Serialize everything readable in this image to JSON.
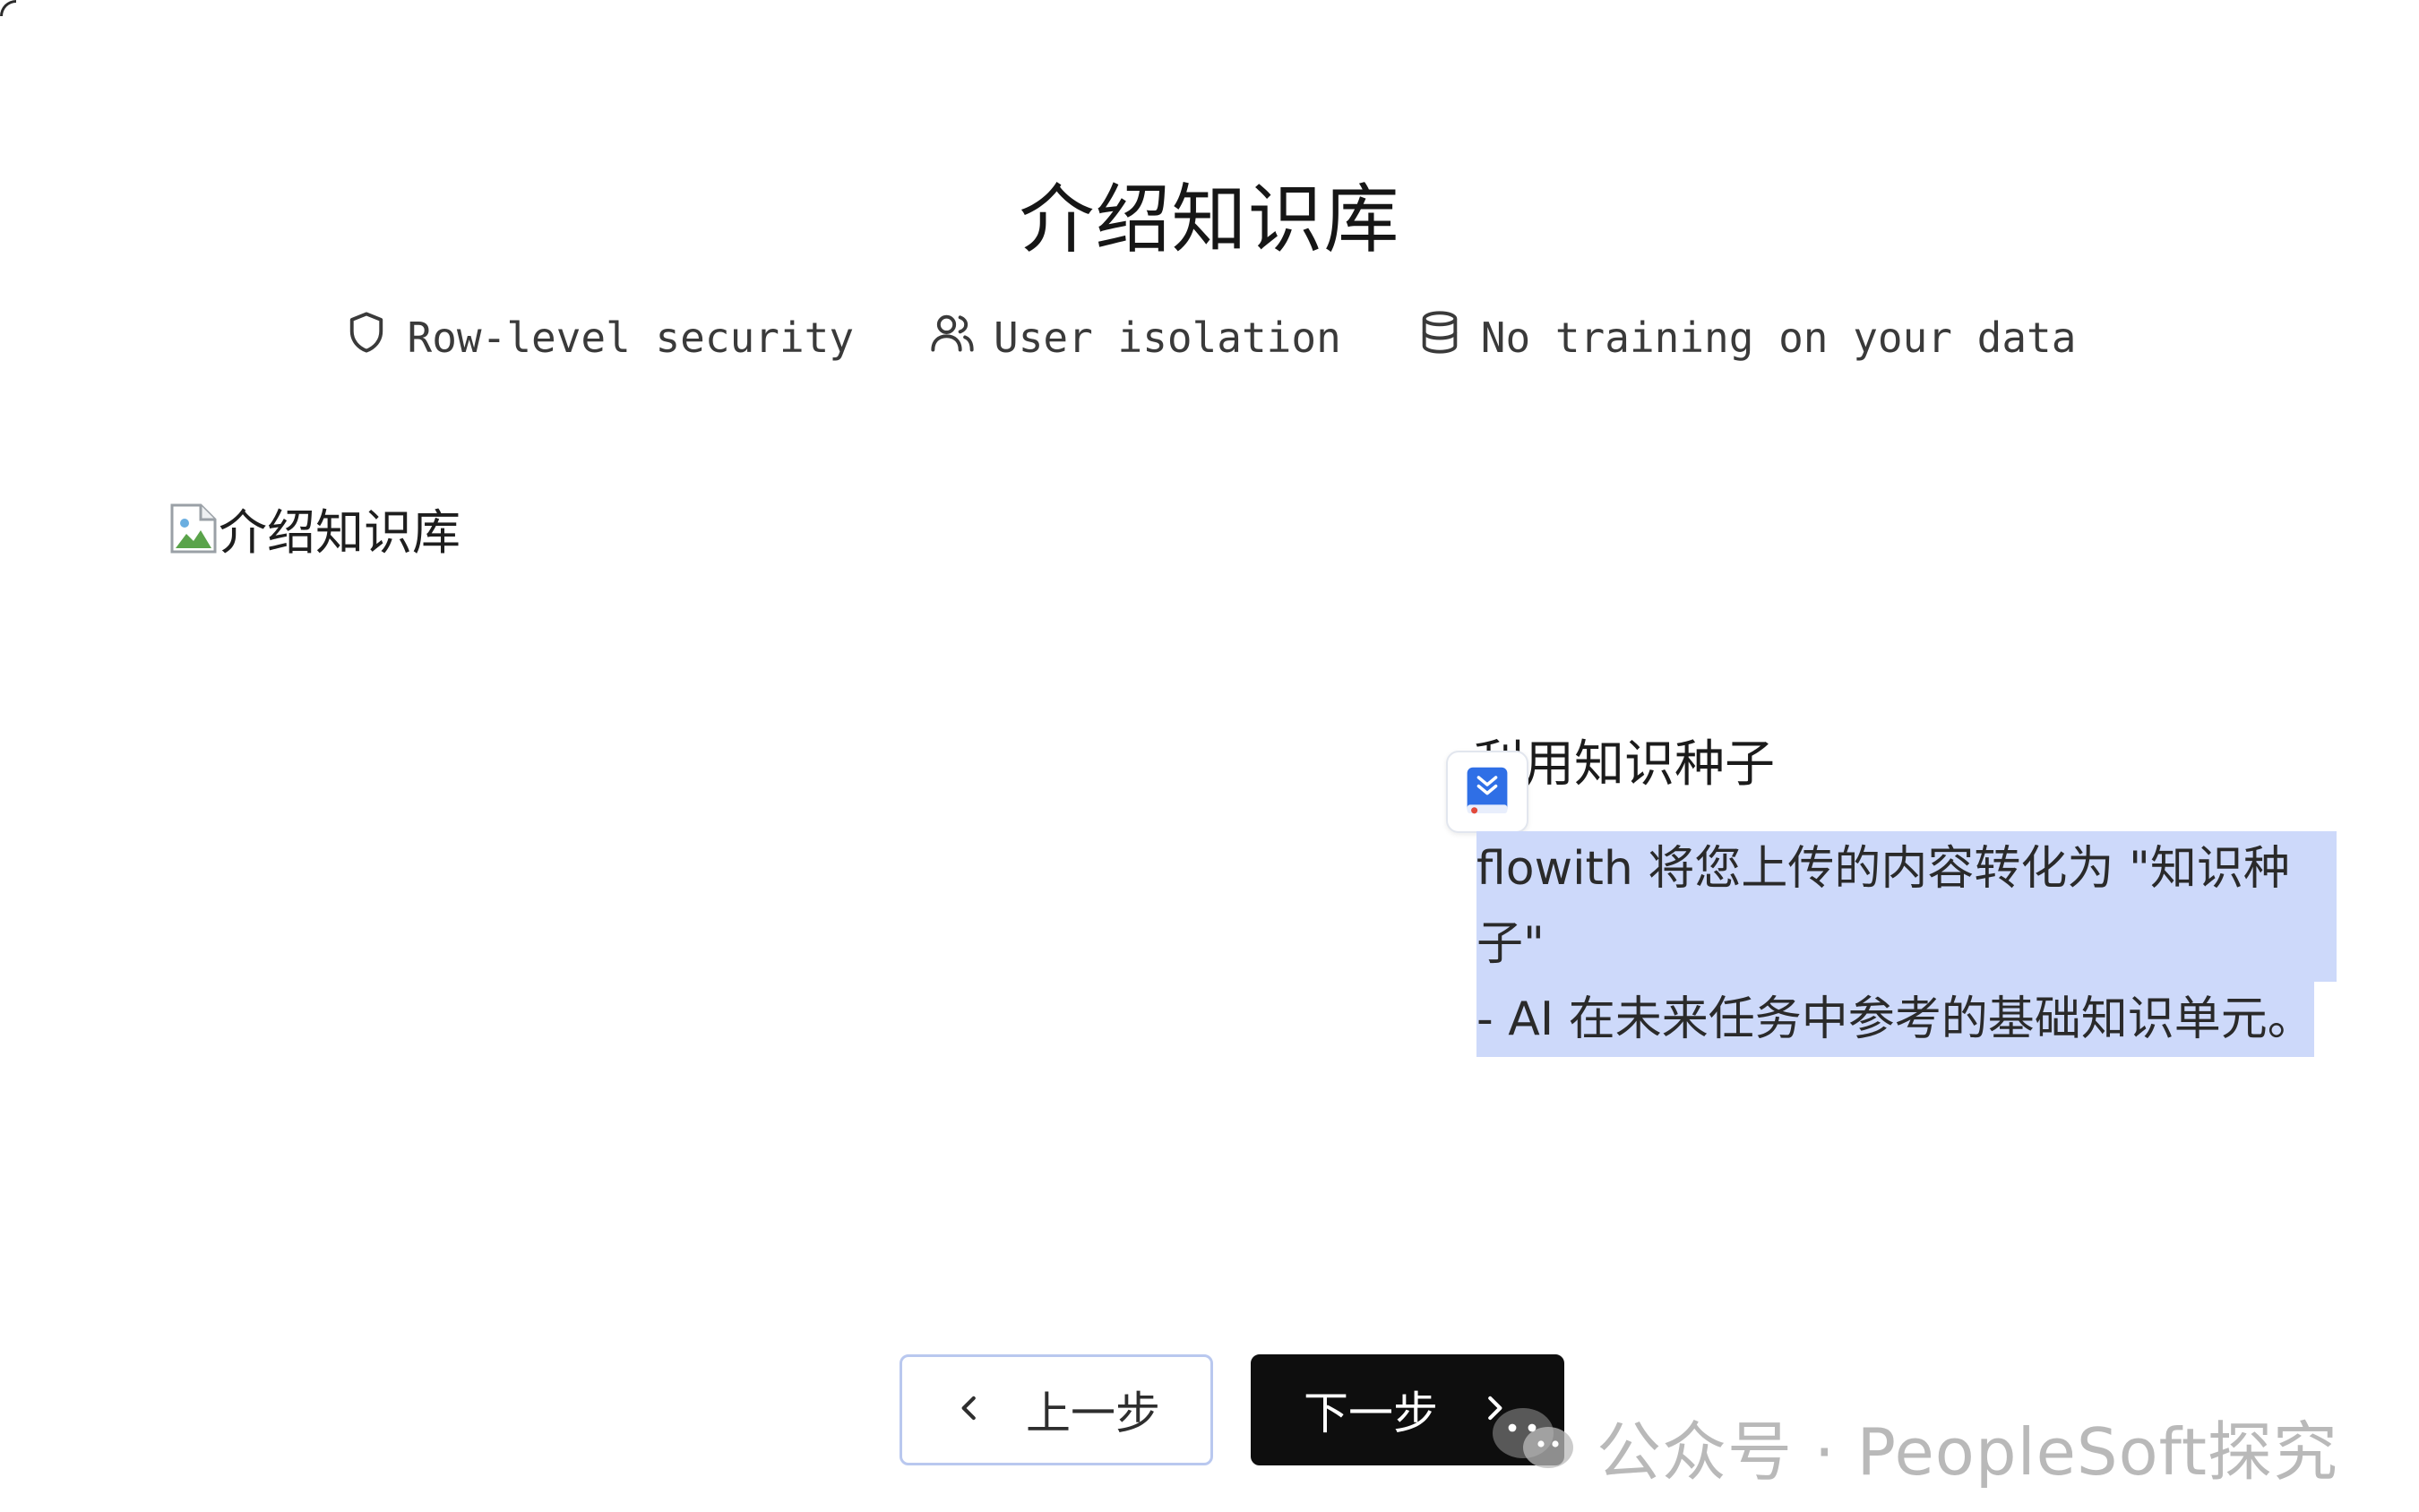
{
  "modal": {
    "title": "介绍知识库"
  },
  "features": [
    {
      "icon": "shield-icon",
      "label": "Row-level security"
    },
    {
      "icon": "users-icon",
      "label": "User isolation"
    },
    {
      "icon": "database-icon",
      "label": "No training on your data"
    }
  ],
  "broken_image": {
    "alt": "介绍知识库",
    "icon": "broken-image-icon"
  },
  "seed": {
    "title": "利用知识种子",
    "icon": "book-download-icon",
    "desc_line1": "flowith 将您上传的内容转化为 \"知识种子\"",
    "desc_line2": "- AI 在未来任务中参考的基础知识单元。"
  },
  "buttons": {
    "prev_label": "上一步",
    "next_label": "下一步"
  },
  "watermark": {
    "text": "公众号 · PeopleSoft探究",
    "icon": "wechat-icon"
  },
  "colors": {
    "highlight": "#cdd9fa",
    "next_button_bg": "#0e0e0e",
    "prev_button_border": "#b9c8ef",
    "accent_blue": "#2f6fe6"
  }
}
